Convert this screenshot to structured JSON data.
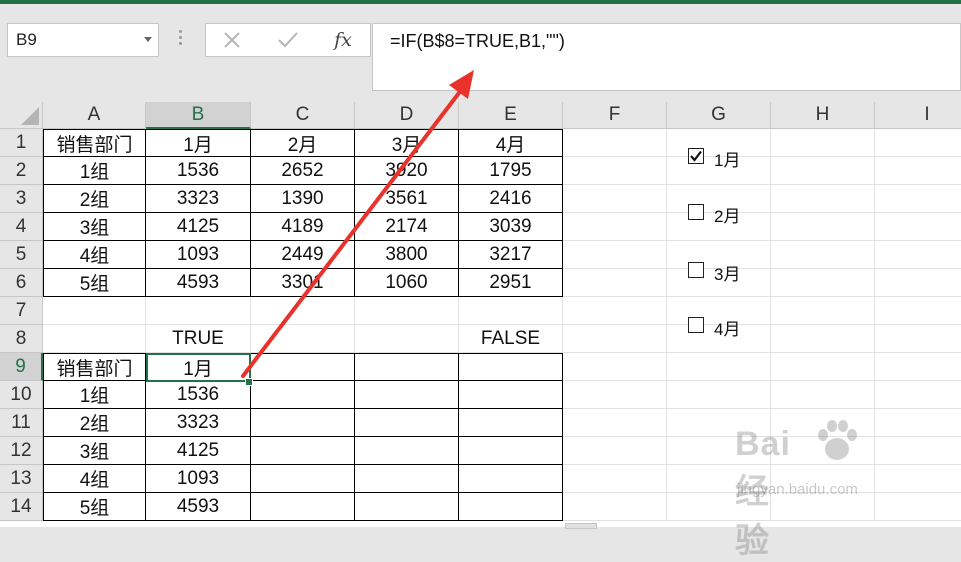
{
  "name_box": {
    "value": "B9"
  },
  "formula_bar": {
    "value": "=IF(B$8=TRUE,B1,\"\")",
    "fx_label": "fx"
  },
  "columns": [
    "A",
    "B",
    "C",
    "D",
    "E",
    "F",
    "G",
    "H",
    "I"
  ],
  "rows": [
    "1",
    "2",
    "3",
    "4",
    "5",
    "6",
    "7",
    "8",
    "9",
    "10",
    "11",
    "12",
    "13",
    "14"
  ],
  "cells": {
    "A1": "销售部门",
    "B1": "1月",
    "C1": "2月",
    "D1": "3月",
    "E1": "4月",
    "A2": "1组",
    "B2": "1536",
    "C2": "2652",
    "D2": "3920",
    "E2": "1795",
    "A3": "2组",
    "B3": "3323",
    "C3": "1390",
    "D3": "3561",
    "E3": "2416",
    "A4": "3组",
    "B4": "4125",
    "C4": "4189",
    "D4": "2174",
    "E4": "3039",
    "A5": "4组",
    "B5": "1093",
    "C5": "2449",
    "D5": "3800",
    "E5": "3217",
    "A6": "5组",
    "B6": "4593",
    "C6": "3301",
    "D6": "1060",
    "E6": "2951",
    "B8": "TRUE",
    "E8": "FALSE",
    "A9": "销售部门",
    "B9": "1月",
    "A10": "1组",
    "B10": "1536",
    "A11": "2组",
    "B11": "3323",
    "A12": "3组",
    "B12": "4125",
    "A13": "4组",
    "B13": "1093",
    "A14": "5组",
    "B14": "4593"
  },
  "checkboxes": [
    {
      "label": "1月",
      "checked": true
    },
    {
      "label": "2月",
      "checked": false
    },
    {
      "label": "3月",
      "checked": false
    },
    {
      "label": "4月",
      "checked": false
    }
  ],
  "watermark": {
    "logo": "Bai  经验",
    "url": "jingyan.baidu.com"
  },
  "colors": {
    "accent": "#217346",
    "annotation_arrow": "#e8322b"
  }
}
